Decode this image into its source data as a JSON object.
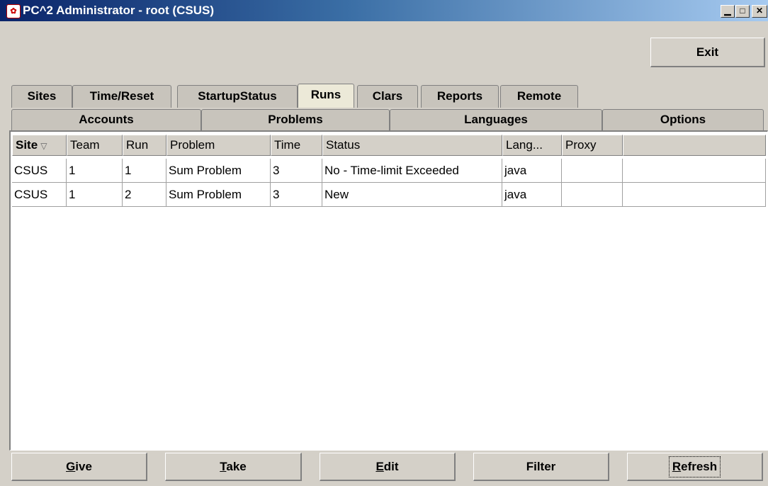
{
  "window": {
    "title": "PC^2 Administrator  - root (CSUS)",
    "icon": "pc2-app-icon",
    "controls": [
      "minimize-icon",
      "maximize-icon",
      "close-icon"
    ]
  },
  "toolbar": {
    "exit_label": "Exit"
  },
  "tabs_row1": [
    {
      "label": "Sites"
    },
    {
      "label": "Time/Reset"
    },
    {
      "label": "StartupStatus"
    },
    {
      "label": "Runs",
      "selected": true
    },
    {
      "label": "Clars"
    },
    {
      "label": "Reports"
    },
    {
      "label": "Remote"
    }
  ],
  "tabs_row2": [
    {
      "label": "Accounts"
    },
    {
      "label": "Problems"
    },
    {
      "label": "Languages"
    },
    {
      "label": "Options"
    }
  ],
  "table": {
    "columns": [
      "Site",
      "Team",
      "Run",
      "Problem",
      "Time",
      "Status",
      "Lang...",
      "Proxy",
      ""
    ],
    "sort_column": "Site",
    "sort_indicator": "▽",
    "rows": [
      [
        "CSUS",
        "1",
        "1",
        "Sum Problem",
        "3",
        "No - Time-limit Exceeded",
        "java",
        "",
        ""
      ],
      [
        "CSUS",
        "1",
        "2",
        "Sum Problem",
        "3",
        "New",
        "java",
        "",
        ""
      ]
    ]
  },
  "actions": {
    "give": {
      "mnemonic": "G",
      "rest": "ive"
    },
    "take": {
      "mnemonic": "T",
      "rest": "ake"
    },
    "edit": {
      "mnemonic": "E",
      "rest": "dit"
    },
    "filter": {
      "label": "Filter"
    },
    "refresh": {
      "mnemonic": "R",
      "rest": "efresh"
    }
  }
}
